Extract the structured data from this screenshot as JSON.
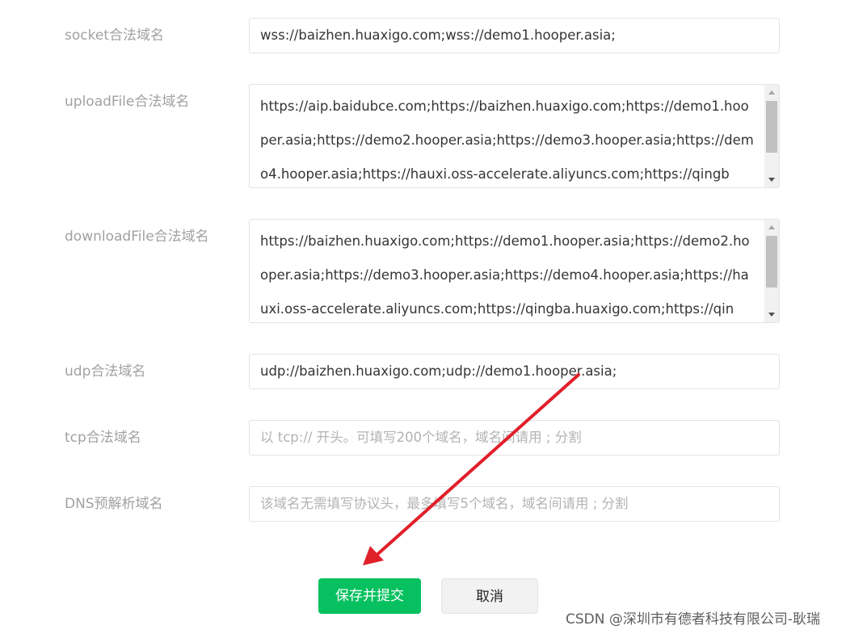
{
  "rows": {
    "socket": {
      "label": "socket合法域名",
      "value": "wss://baizhen.huaxigo.com;wss://demo1.hooper.asia;"
    },
    "upload": {
      "label": "uploadFile合法域名",
      "value": "https://aip.baidubce.com;https://baizhen.huaxigo.com;https://demo1.hooper.asia;https://demo2.hooper.asia;https://demo3.hooper.asia;https://demo4.hooper.asia;https://hauxi.oss-accelerate.aliyuncs.com;https://qingb"
    },
    "download": {
      "label": "downloadFile合法域名",
      "value": "https://baizhen.huaxigo.com;https://demo1.hooper.asia;https://demo2.hooper.asia;https://demo3.hooper.asia;https://demo4.hooper.asia;https://hauxi.oss-accelerate.aliyuncs.com;https://qingba.huaxigo.com;https://qin"
    },
    "udp": {
      "label": "udp合法域名",
      "value": "udp://baizhen.huaxigo.com;udp://demo1.hooper.asia;"
    },
    "tcp": {
      "label": "tcp合法域名",
      "placeholder": "以 tcp:// 开头。可填写200个域名，域名间请用 ; 分割"
    },
    "dns": {
      "label": "DNS预解析域名",
      "placeholder": "该域名无需填写协议头，最多填写5个域名，域名间请用 ; 分割"
    }
  },
  "buttons": {
    "save": "保存并提交",
    "cancel": "取消"
  },
  "watermark": "CSDN @深圳市有德者科技有限公司-耿瑞",
  "colors": {
    "primary": "#07c160",
    "annotation_arrow": "#e0202a"
  }
}
